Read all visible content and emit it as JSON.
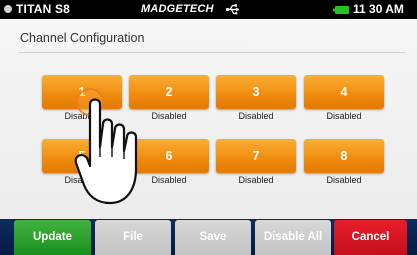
{
  "status_bar": {
    "device_name": "TITAN S8",
    "brand": "MADGETECH",
    "usb_icon": "usb-icon",
    "battery_icon": "battery-icon",
    "battery_color": "#22c51e",
    "time": "11 30 AM"
  },
  "screen": {
    "title": "Channel Configuration"
  },
  "channels": [
    {
      "label": "1",
      "status": "Disabled"
    },
    {
      "label": "2",
      "status": "Disabled"
    },
    {
      "label": "3",
      "status": "Disabled"
    },
    {
      "label": "4",
      "status": "Disabled"
    },
    {
      "label": "5",
      "status": "Disabled"
    },
    {
      "label": "6",
      "status": "Disabled"
    },
    {
      "label": "7",
      "status": "Disabled"
    },
    {
      "label": "8",
      "status": "Disabled"
    }
  ],
  "buttons": {
    "update": "Update",
    "file": "File",
    "save": "Save",
    "disable_all": "Disable All",
    "cancel": "Cancel"
  },
  "colors": {
    "channel_button": "#f08a0c",
    "update": "#1f9a22",
    "cancel": "#d5141f",
    "inactive": "#c8c8c8",
    "bottom_band": "#0a2552"
  },
  "overlay": {
    "icon": "pointing-hand-icon",
    "target": "channel-1"
  }
}
